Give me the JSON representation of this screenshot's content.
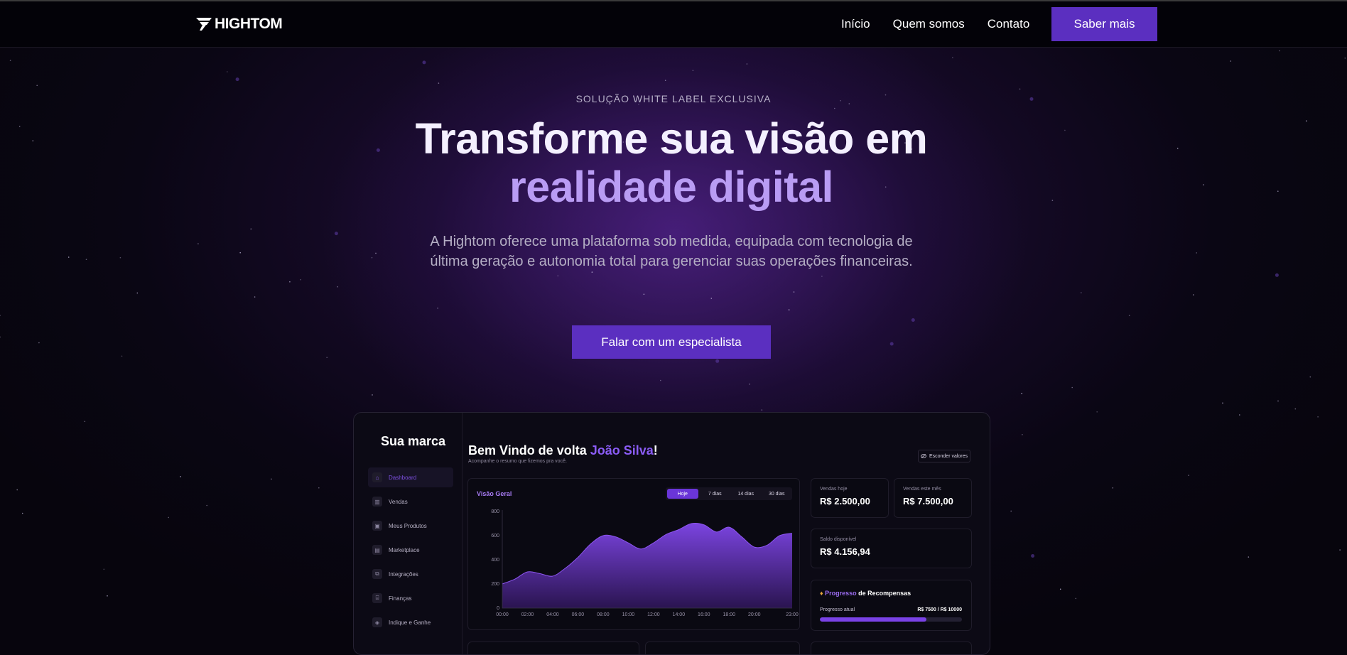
{
  "nav": {
    "logo": "HIGHTOM",
    "links": [
      "Início",
      "Quem somos",
      "Contato"
    ],
    "cta": "Saber mais"
  },
  "hero": {
    "eyebrow": "SOLUÇÃO WHITE LABEL EXCLUSIVA",
    "title_line1": "Transforme sua visão em",
    "title_line2": "realidade digital",
    "subtitle": "A Hightom oferece uma plataforma sob medida, equipada com tecnologia de última geração e autonomia total para gerenciar suas operações financeiras.",
    "cta": "Falar com um especialista"
  },
  "dashboard": {
    "brand": "Sua marca",
    "sidebar": [
      {
        "label": "Dashboard",
        "icon": "home-icon",
        "glyph": "⌂",
        "active": true
      },
      {
        "label": "Vendas",
        "icon": "bar-chart-icon",
        "glyph": "▥",
        "active": false
      },
      {
        "label": "Meus Produtos",
        "icon": "box-icon",
        "glyph": "▣",
        "active": false
      },
      {
        "label": "Marketplace",
        "icon": "store-icon",
        "glyph": "▤",
        "active": false
      },
      {
        "label": "Integrações",
        "icon": "puzzle-icon",
        "glyph": "⧉",
        "active": false
      },
      {
        "label": "Finanças",
        "icon": "bank-icon",
        "glyph": "⌸",
        "active": false
      },
      {
        "label": "Indique e Ganhe",
        "icon": "gift-icon",
        "glyph": "◈",
        "active": false
      }
    ],
    "welcome_prefix": "Bem Vindo de volta ",
    "welcome_name": "João Silva",
    "welcome_suffix": "!",
    "welcome_sub": "Acompanhe o resumo que fizemos pra você.",
    "hide_values": "Esconder valores",
    "chart_panel": {
      "title": "Visão Geral",
      "tabs": [
        "Hoje",
        "7 dias",
        "14 dias",
        "30 dias"
      ],
      "active_tab": 0
    },
    "stats": {
      "sales_today_label": "Vendas hoje",
      "sales_today_value": "R$ 2.500,00",
      "sales_month_label": "Vendas este mês",
      "sales_month_value": "R$ 7.500,00",
      "balance_label": "Saldo disponível",
      "balance_value": "R$ 4.156,94"
    },
    "rewards": {
      "title_hl": "Progresso",
      "title_rest": " de Recompensas",
      "current_label": "Progresso atual",
      "amount": "R$ 7500 / R$ 10000",
      "progress": 0.75
    }
  },
  "chart_data": {
    "type": "area",
    "x": [
      "00:00",
      "01:00",
      "02:00",
      "03:00",
      "04:00",
      "05:00",
      "06:00",
      "07:00",
      "08:00",
      "09:00",
      "10:00",
      "11:00",
      "12:00",
      "13:00",
      "14:00",
      "15:00",
      "16:00",
      "17:00",
      "18:00",
      "19:00",
      "20:00",
      "21:00",
      "22:00",
      "23:00"
    ],
    "xticks": [
      "00:00",
      "02:00",
      "04:00",
      "06:00",
      "08:00",
      "10:00",
      "12:00",
      "14:00",
      "16:00",
      "18:00",
      "20:00",
      "23:00"
    ],
    "values": [
      200,
      240,
      300,
      285,
      265,
      330,
      420,
      530,
      600,
      590,
      540,
      490,
      540,
      610,
      650,
      700,
      690,
      630,
      670,
      590,
      505,
      520,
      600,
      620
    ],
    "ylim": [
      0,
      800
    ],
    "yticks": [
      0,
      200,
      400,
      600,
      800
    ],
    "colors": {
      "fill_top": "#7b44e0",
      "fill_bottom": "#2a1450",
      "line": "#8d55f0"
    },
    "grid": false
  }
}
